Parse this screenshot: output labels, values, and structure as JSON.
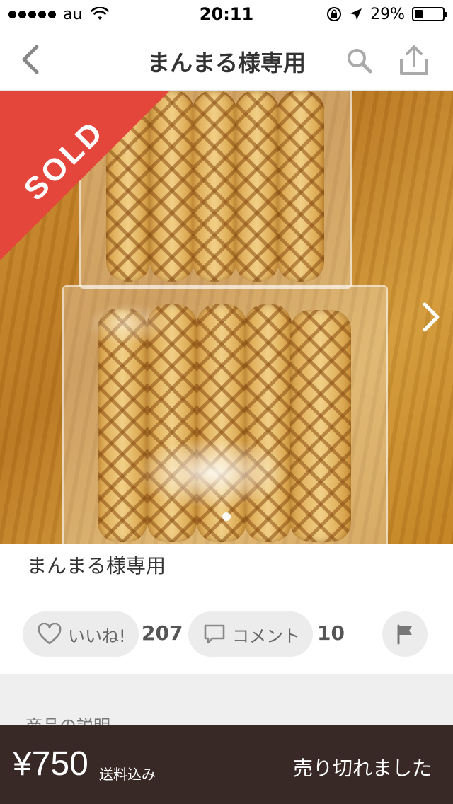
{
  "status_bar": {
    "carrier": "au",
    "time": "20:11",
    "battery_percent": "29%",
    "battery_level": 0.29
  },
  "nav": {
    "title": "まんまる様専用",
    "back_icon": "chevron-left-icon",
    "search_icon": "search-icon",
    "share_icon": "share-icon"
  },
  "image": {
    "sold_label": "SOLD",
    "page_count": 1,
    "current_page": 1
  },
  "item": {
    "name": "まんまる様専用"
  },
  "actions": {
    "like_label": "いいね!",
    "like_count": "207",
    "comment_label": "コメント",
    "comment_count": "10"
  },
  "section": {
    "description_label": "商品の説明"
  },
  "bottom_bar": {
    "price": "¥750",
    "shipping": "送料込み",
    "status": "売り切れました"
  },
  "colors": {
    "sold_banner": "#e5463b",
    "bottom_bar": "#382927",
    "pill_bg": "#ececec"
  }
}
